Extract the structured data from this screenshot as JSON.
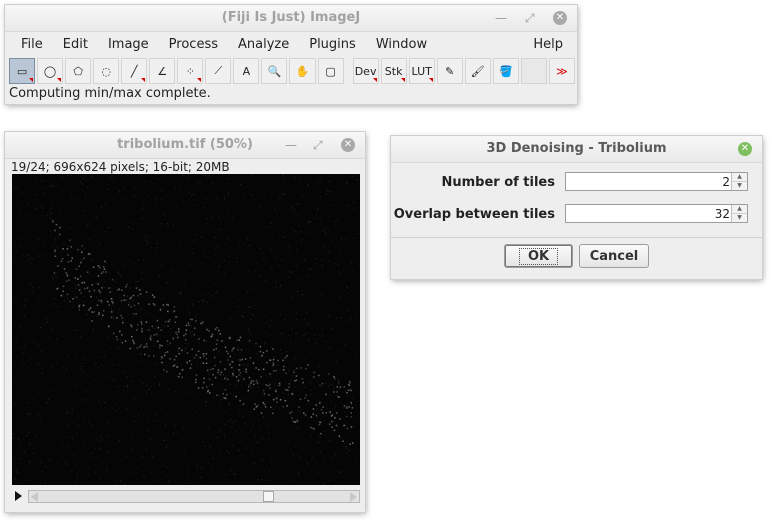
{
  "imagej": {
    "title": "(Fiji Is Just) ImageJ",
    "menu": [
      "File",
      "Edit",
      "Image",
      "Process",
      "Analyze",
      "Plugins",
      "Window",
      "Help"
    ],
    "tools": [
      {
        "name": "rectangle-tool-icon",
        "glyph": "▭",
        "selected": true,
        "more": true
      },
      {
        "name": "oval-tool-icon",
        "glyph": "◯",
        "more": true
      },
      {
        "name": "polygon-tool-icon",
        "glyph": "⬠",
        "more": false
      },
      {
        "name": "freehand-tool-icon",
        "glyph": "◌",
        "more": false
      },
      {
        "name": "line-tool-icon",
        "glyph": "╱",
        "more": true
      },
      {
        "name": "angle-tool-icon",
        "glyph": "∠",
        "more": false
      },
      {
        "name": "point-tool-icon",
        "glyph": "⁘",
        "more": true
      },
      {
        "name": "wand-tool-icon",
        "glyph": "⟋",
        "more": false
      },
      {
        "name": "text-tool-icon",
        "glyph": "A",
        "more": false
      },
      {
        "name": "zoom-tool-icon",
        "glyph": "🔍",
        "more": false
      },
      {
        "name": "hand-tool-icon",
        "glyph": "✋",
        "more": false
      },
      {
        "name": "color-picker-tool-icon",
        "glyph": "▢",
        "more": false
      },
      {
        "name": "dev-tool-icon",
        "glyph": "Dev",
        "more": true,
        "gap": true
      },
      {
        "name": "stk-tool-icon",
        "glyph": "Stk",
        "more": true
      },
      {
        "name": "lut-tool-icon",
        "glyph": "LUT",
        "more": true
      },
      {
        "name": "pencil-tool-icon",
        "glyph": "✎",
        "more": false
      },
      {
        "name": "brush-tool-icon",
        "glyph": "🖌",
        "more": false
      },
      {
        "name": "flood-fill-tool-icon",
        "glyph": "🪣",
        "more": false
      },
      {
        "name": "empty-tool-slot",
        "glyph": "",
        "more": false,
        "empty": true
      },
      {
        "name": "more-tools-icon",
        "glyph": "≫",
        "more": false
      }
    ],
    "status": "Computing min/max complete."
  },
  "image_window": {
    "title": "tribolium.tif (50%)",
    "info": "19/24; 696x624 pixels; 16-bit; 20MB",
    "slice_fraction": 0.75
  },
  "dialog": {
    "title": "3D Denoising - Tribolium",
    "fields": [
      {
        "label": "Number of tiles",
        "value": "2"
      },
      {
        "label": "Overlap between tiles",
        "value": "32"
      }
    ],
    "ok_label": "OK",
    "cancel_label": "Cancel"
  },
  "colors": {
    "accent_red": "#d00000",
    "close_green": "#7fbf5f",
    "image_bg": "#050505"
  }
}
